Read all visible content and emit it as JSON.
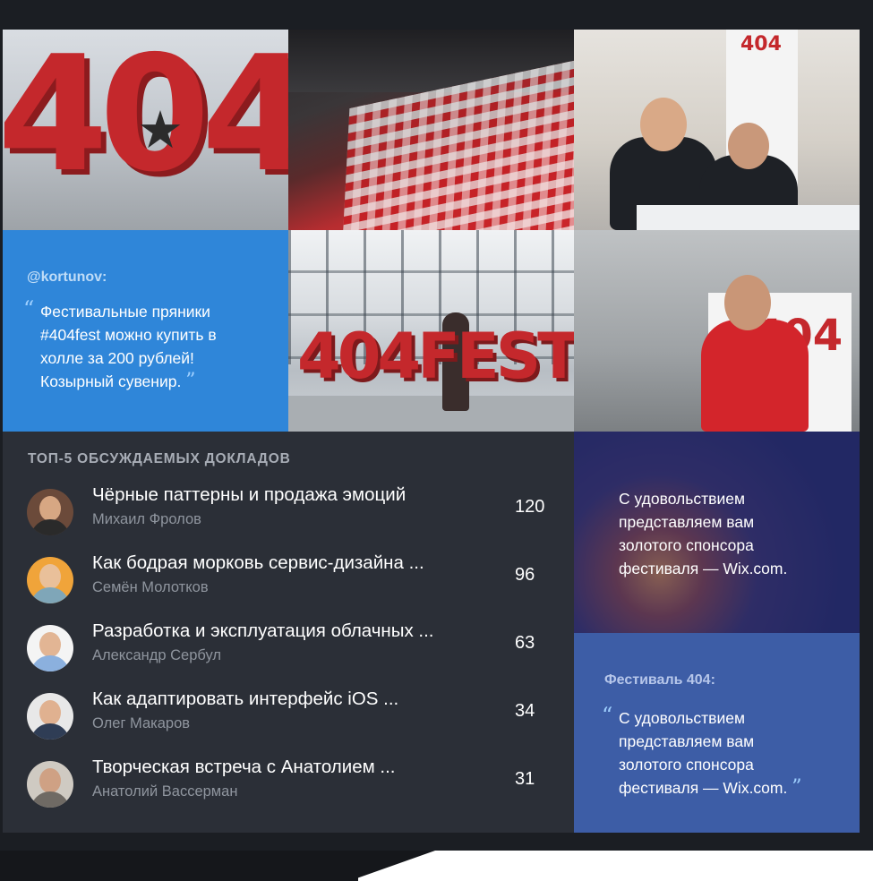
{
  "quote_tile": {
    "author": "@kortunov:",
    "open_mark": "“",
    "close_mark": "”",
    "lines": [
      "Фестивальные пряники",
      "#404fest можно купить в",
      "холле за 200 рублей!",
      "Козырный сувенир."
    ]
  },
  "photos": {
    "photo1_text": "404",
    "photo4_text": "404FEST",
    "photo5_text": "404",
    "photo3_text": "404"
  },
  "top5": {
    "title": "ТОП-5 ОБСУЖДАЕМЫХ ДОКЛАДОВ",
    "items": [
      {
        "title": "Чёрные паттерны и продажа эмоций",
        "author": "Михаил Фролов",
        "count": "120"
      },
      {
        "title": "Как бодрая морковь сервис-дизайна ...",
        "author": "Семён Молотков",
        "count": "96"
      },
      {
        "title": "Разработка и эксплуатация облачных ...",
        "author": "Александр Сербул",
        "count": "63"
      },
      {
        "title": "Как адаптировать интерфейс iOS ...",
        "author": "Олег Макаров",
        "count": "34"
      },
      {
        "title": "Творческая встреча с Анатолием ...",
        "author": "Анатолий Вассерман",
        "count": "31"
      }
    ]
  },
  "sponsor_tile": {
    "lines": [
      "С удовольствием",
      "представляем вам",
      "золотого спонсора",
      "фестиваля — Wix.com."
    ]
  },
  "festival_quote": {
    "author": "Фестиваль 404:",
    "open_mark": "“",
    "close_mark": "”",
    "lines": [
      "С удовольствием",
      "представляем вам",
      "золотого спонсора",
      "фестиваля — Wix.com."
    ]
  },
  "colors": {
    "blue_tile": "#2f86d9",
    "dark_tile": "#2b2f37",
    "indigo_tile": "#3d5da6",
    "brand_red": "#c4282c"
  }
}
